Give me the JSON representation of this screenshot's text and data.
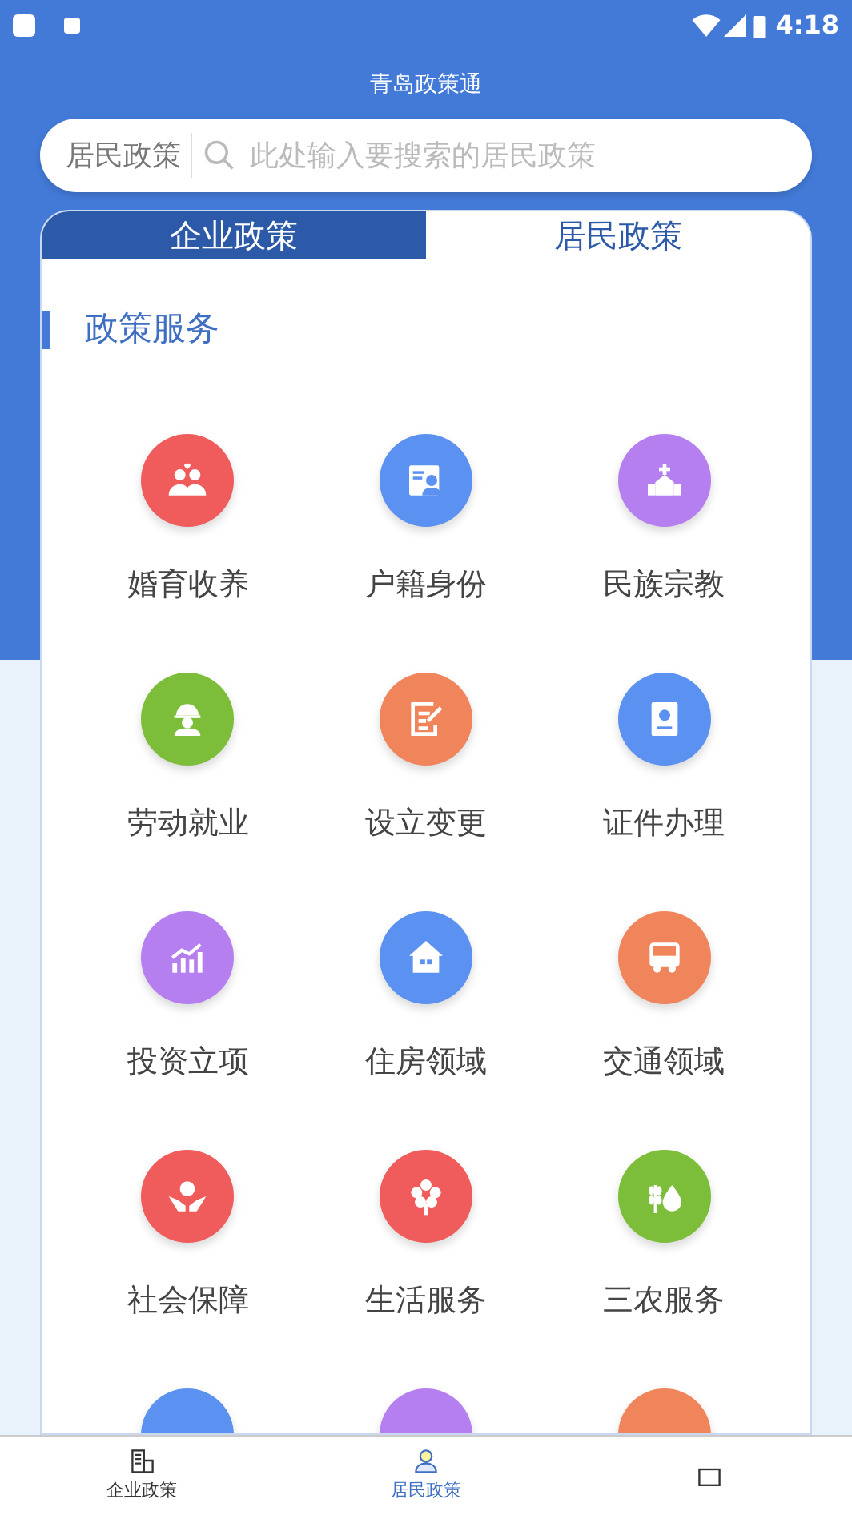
{
  "status_bar": {
    "time": "4:18"
  },
  "title": "青岛政策通",
  "search": {
    "scope": "居民政策",
    "placeholder": "此处输入要搜索的居民政策"
  },
  "tabs": [
    {
      "label": "企业政策",
      "selected": false
    },
    {
      "label": "居民政策",
      "selected": true
    }
  ],
  "section": {
    "title": "政策服务"
  },
  "services": [
    {
      "label": "婚育收养",
      "color": "#f05b5b"
    },
    {
      "label": "户籍身份",
      "color": "#5b91f0"
    },
    {
      "label": "民族宗教",
      "color": "#b57ff0"
    },
    {
      "label": "劳动就业",
      "color": "#7cbd3a"
    },
    {
      "label": "设立变更",
      "color": "#f0845a"
    },
    {
      "label": "证件办理",
      "color": "#5b91f0"
    },
    {
      "label": "投资立项",
      "color": "#b57ff0"
    },
    {
      "label": "住房领域",
      "color": "#5b91f0"
    },
    {
      "label": "交通领域",
      "color": "#f0845a"
    },
    {
      "label": "社会保障",
      "color": "#f05b5b"
    },
    {
      "label": "生活服务",
      "color": "#f05b5b"
    },
    {
      "label": "三农服务",
      "color": "#7cbd3a"
    },
    {
      "color": "#5b91f0"
    },
    {
      "color": "#b57ff0"
    },
    {
      "color": "#f0845a"
    }
  ],
  "bottom_nav": [
    {
      "label": "企业政策",
      "selected": false
    },
    {
      "label": "居民政策",
      "selected": true
    },
    {
      "selected": false
    }
  ]
}
